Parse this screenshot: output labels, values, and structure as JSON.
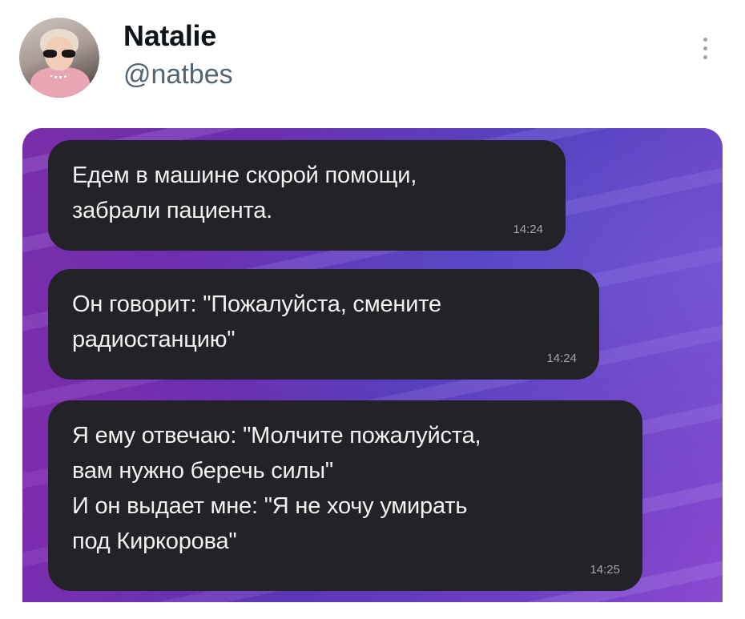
{
  "user": {
    "display_name": "Natalie",
    "handle": "@natbes"
  },
  "icons": {
    "more": "more-vertical-icon",
    "avatar": "profile-photo"
  },
  "messages": [
    {
      "text": "Едем в машине скорой помощи,\nзабрали пациента.",
      "time": "14:24"
    },
    {
      "text": "Он говорит: \"Пожалуйста, смените\nрадиостанцию\"",
      "time": "14:24"
    },
    {
      "text": "Я ему отвечаю: \"Молчите пожалуйста,\nвам нужно беречь силы\"\nИ он выдает мне: \"Я не хочу умирать\nпод Киркорова\"",
      "time": "14:25"
    }
  ],
  "colors": {
    "bubble": "#232226",
    "media_purple": "#6b2fb0",
    "handle_gray": "#536471"
  }
}
